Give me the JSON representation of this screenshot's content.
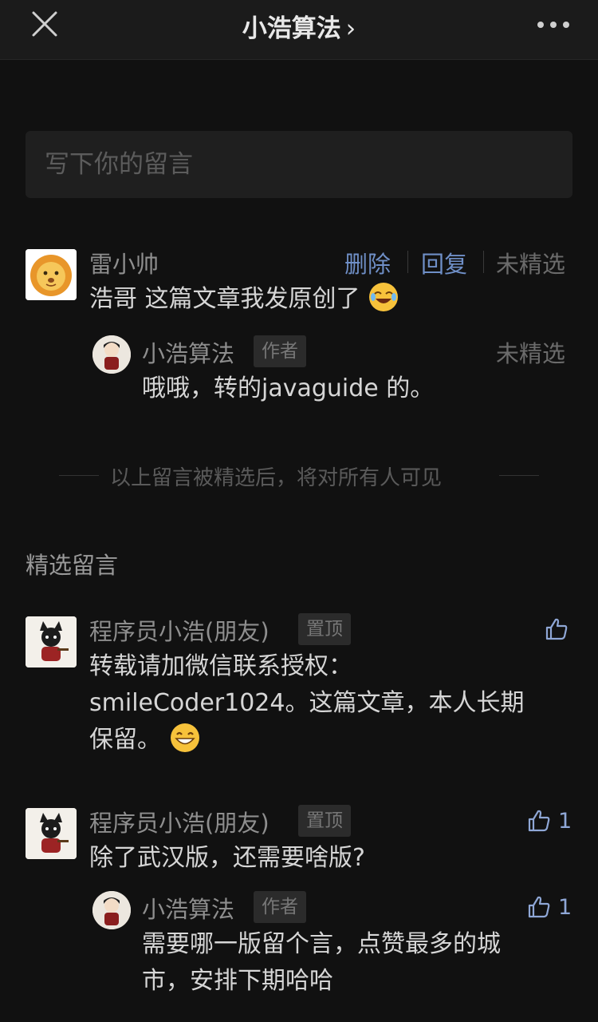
{
  "header": {
    "title": "小浩算法",
    "chevron": "›",
    "close_icon": "close-icon",
    "more_icon": "more-dots-icon"
  },
  "compose": {
    "placeholder": "写下你的留言"
  },
  "my_comment": {
    "author": "雷小帅",
    "actions": {
      "delete": "删除",
      "reply": "回复",
      "status": "未精选"
    },
    "text": "浩哥 这篇文章我发原创了",
    "emoji": "😂",
    "reply": {
      "author": "小浩算法",
      "badge": "作者",
      "status": "未精选",
      "text": "哦哦，转的javaguide 的。"
    }
  },
  "notice": "以上留言被精选后，将对所有人可见",
  "featured": {
    "section_title": "精选留言",
    "comments": [
      {
        "author": "程序员小浩(朋友)",
        "badge": "置顶",
        "line1": "转载请加微信联系授权：",
        "line2": "smileCoder1024。这篇文章，本人长期",
        "line3": "保留。",
        "emoji": "😄",
        "likes": ""
      },
      {
        "author": "程序员小浩(朋友)",
        "badge": "置顶",
        "text": "除了武汉版，还需要啥版?",
        "likes": "1",
        "reply": {
          "author": "小浩算法",
          "badge": "作者",
          "likes": "1",
          "line1": "需要哪一版留个言，点赞最多的城",
          "line2": "市，安排下期哈哈"
        }
      }
    ]
  },
  "colors": {
    "background": "#111111",
    "link": "#6f8fc7",
    "like": "#8fa7d6"
  }
}
